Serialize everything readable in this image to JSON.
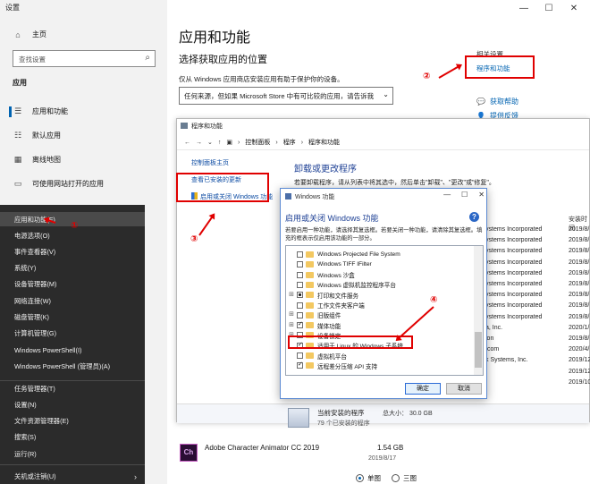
{
  "window": {
    "title": "设置",
    "controls": [
      "—",
      "☐",
      "✕"
    ]
  },
  "sidebar": {
    "home": "主页",
    "search_placeholder": "查找设置",
    "group": "应用",
    "items": [
      "应用和功能",
      "默认应用",
      "离线地图",
      "可使用网站打开的应用"
    ]
  },
  "main": {
    "title": "应用和功能",
    "subtitle": "选择获取应用的位置",
    "desc": "仅从 Windows 应用商店安装应用有助于保护你的设备。",
    "source": "任何来源，但如果 Microsoft Store 中有可比较的应用，请告诉我",
    "related_heading": "相关设置",
    "related_link": "程序和功能",
    "help": "获取帮助",
    "feedback": "提供反馈"
  },
  "pf": {
    "title": "程序和功能",
    "breadcrumb": [
      "控制面板",
      "程序",
      "程序和功能"
    ],
    "left_home": "控制面板主页",
    "left_updates": "查看已安装的更新",
    "left_features": "启用或关闭 Windows 功能",
    "heading": "卸载或更改程序",
    "desc": "若要卸载程序，请从列表中将其选中，然后单击\"卸载\"、\"更改\"或\"修复\"。",
    "col_install": "安装时间",
    "rows": [
      {
        "pub": "ystems Incorporated",
        "date": "2019/8/"
      },
      {
        "pub": "ystems Incorporated",
        "date": "2019/8/"
      },
      {
        "pub": "ystems Incorporated",
        "date": "2019/8/"
      },
      {
        "pub": "ystems Incorporated",
        "date": "2019/8/"
      },
      {
        "pub": "ystems Incorporated",
        "date": "2019/8/"
      },
      {
        "pub": "ystems Incorporated",
        "date": "2019/8/"
      },
      {
        "pub": "ystems Incorporated",
        "date": "2019/8/"
      },
      {
        "pub": "ystems Incorporated",
        "date": "2019/8/"
      },
      {
        "pub": "ystems Incorporated",
        "date": "2019/8/"
      },
      {
        "pub": "a, Inc.",
        "date": "2020/1/"
      },
      {
        "pub": "ion",
        "date": "2019/8/"
      },
      {
        "pub": ".com",
        "date": "2020/4/"
      },
      {
        "pub": "k Systems, Inc.",
        "date": "2019/12/"
      },
      {
        "pub": "",
        "date": "2019/12/"
      },
      {
        "pub": "",
        "date": "2019/10/"
      }
    ],
    "current_installed": "当前安装的程序",
    "current_count": "79 个已安装的程序",
    "current_size": "总大小：   30.0 GB"
  },
  "wf": {
    "title": "Windows 功能",
    "heading": "启用或关闭 Windows 功能",
    "help": "?",
    "desc": "若要启用一种功能，请选择其复选框。若要关闭一种功能，请清除其复选框。填充的框表示仅启用该功能的一部分。",
    "items": [
      {
        "label": "Windows Projected File System",
        "state": "off",
        "exp": false
      },
      {
        "label": "Windows TIFF IFilter",
        "state": "off",
        "exp": false
      },
      {
        "label": "Windows 沙盒",
        "state": "off",
        "exp": false
      },
      {
        "label": "Windows 虚拟机监控程序平台",
        "state": "off",
        "exp": false
      },
      {
        "label": "打印和文件服务",
        "state": "part",
        "exp": true
      },
      {
        "label": "工作文件夹客户端",
        "state": "off",
        "exp": false
      },
      {
        "label": "旧版组件",
        "state": "off",
        "exp": true
      },
      {
        "label": "媒体功能",
        "state": "chk",
        "exp": true
      },
      {
        "label": "设备锁定",
        "state": "off",
        "exp": true
      },
      {
        "label": "适用于 Linux 的 Windows 子系统",
        "state": "chk",
        "exp": false
      },
      {
        "label": "虚拟机平台",
        "state": "off",
        "exp": false
      },
      {
        "label": "远程差分压缩 API 支持",
        "state": "chk",
        "exp": false
      }
    ],
    "ok": "确定",
    "cancel": "取消"
  },
  "ctx": {
    "items": [
      "应用和功能(F)",
      "电源选项(O)",
      "事件查看器(V)",
      "系统(Y)",
      "设备管理器(M)",
      "网络连接(W)",
      "磁盘管理(K)",
      "计算机管理(G)",
      "Windows PowerShell(I)",
      "Windows PowerShell (管理员)(A)",
      "任务管理器(T)",
      "设置(N)",
      "文件资源管理器(E)",
      "搜索(S)",
      "运行(R)",
      "关机或注销(U)"
    ]
  },
  "markers": [
    "①",
    "②",
    "③",
    "④"
  ],
  "bottom": {
    "app_icon": "Ch",
    "app_name": "Adobe Character Animator CC 2019",
    "app_size": "1.54 GB",
    "app_date": "2019/8/17",
    "radio_single": "单图",
    "radio_triple": "三图"
  },
  "colors": {
    "accent": "#0063b1",
    "annotation": "#e00000",
    "menu_bg": "#2b2b2b"
  }
}
